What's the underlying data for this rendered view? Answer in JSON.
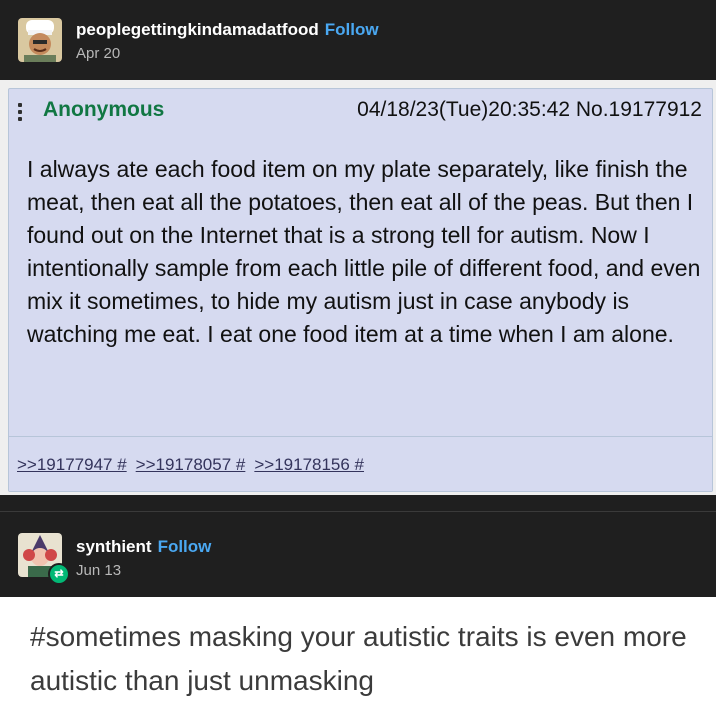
{
  "post": {
    "author": "peoplegettingkindamadatfood",
    "follow_label": "Follow",
    "date": "Apr 20"
  },
  "screenshot": {
    "name": "Anonymous",
    "datetime": "04/18/23(Tue)20:35:42",
    "post_number": "No.19177912",
    "body": "I always ate each food item on my plate separately, like finish the meat, then eat all the potatoes, then eat all of the peas. But then I found out on the Internet that is a strong tell for autism. Now I intentionally sample from each little pile of different food, and even mix it sometimes, to hide my autism just in case anybody is watching me eat. I eat one food item at a time when I am alone.",
    "backlinks": [
      ">>19177947 #",
      ">>19178057 #",
      ">>19178156 #"
    ],
    "colors": {
      "name_green": "#117743",
      "post_bg": "#d6daf0",
      "border": "#b7c5d9"
    }
  },
  "reblog": {
    "author": "synthient",
    "follow_label": "Follow",
    "date": "Jun 13",
    "tags": "#sometimes masking your autistic traits is even more autistic than just unmasking"
  },
  "icons": {
    "reblog_badge": "reblog-icon",
    "menu": "vertical-dots-icon"
  }
}
